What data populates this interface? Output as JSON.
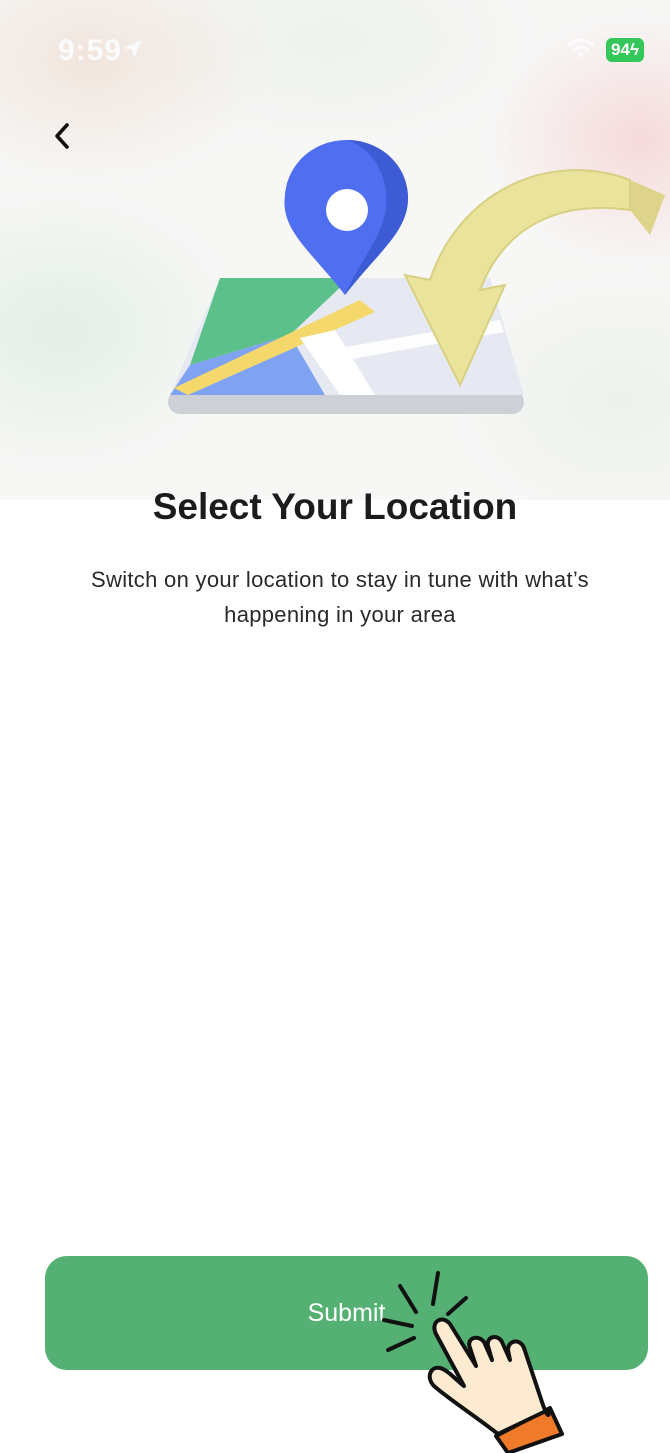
{
  "status_bar": {
    "time": "9:59",
    "battery": "94",
    "icons": [
      "location-arrow-icon",
      "wifi-icon",
      "battery-icon"
    ]
  },
  "header": {
    "back_icon": "chevron-left-icon"
  },
  "content": {
    "illustration": "map-pin-with-arrow-illustration",
    "title": "Select Your Location",
    "subtitle": "Switch on your location to stay in tune with what’s happening in your area"
  },
  "footer": {
    "submit_label": "Submit",
    "overlay_icon": "tap-hand-icon"
  },
  "colors": {
    "primary_button": "#55b074",
    "title_text": "#1c1c1c",
    "pin_blue": "#4f6ff0",
    "map_green": "#5cc08a",
    "arrow_yellow": "#eae39c"
  }
}
